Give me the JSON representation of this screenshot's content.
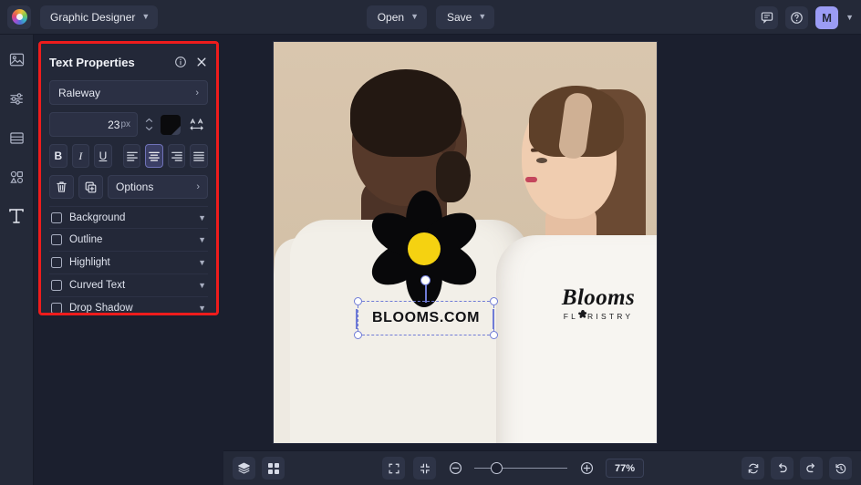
{
  "topbar": {
    "logo_name": "app-logo",
    "project_name": "Graphic Designer",
    "open_label": "Open",
    "save_label": "Save",
    "comment_icon": "comment-icon",
    "help_icon": "help-icon",
    "avatar_initial": "M"
  },
  "rail": {
    "items": [
      {
        "icon": "image-icon",
        "label": "Images"
      },
      {
        "icon": "adjustments-icon",
        "label": "Adjust"
      },
      {
        "icon": "layers-panel-icon",
        "label": "Layouts"
      },
      {
        "icon": "shapes-icon",
        "label": "Elements"
      },
      {
        "icon": "text-icon",
        "label": "Text"
      }
    ]
  },
  "panel": {
    "title": "Text Properties",
    "info_icon": "info-icon",
    "close_icon": "close-icon",
    "font_family": "Raleway",
    "font_size": "23",
    "font_size_unit": "px",
    "color_swatch": "#0b0b0d",
    "letter_spacing_icon": "letter-spacing-icon",
    "bold_label": "B",
    "italic_label": "I",
    "underline_label": "U",
    "align_options": [
      "align-left",
      "align-center",
      "align-right",
      "align-justify"
    ],
    "align_selected": "align-center",
    "delete_icon": "trash-icon",
    "duplicate_icon": "duplicate-icon",
    "options_label": "Options",
    "sections": [
      {
        "label": "Background",
        "checked": false
      },
      {
        "label": "Outline",
        "checked": false
      },
      {
        "label": "Highlight",
        "checked": false
      },
      {
        "label": "Curved Text",
        "checked": false
      },
      {
        "label": "Drop Shadow",
        "checked": false
      }
    ],
    "highlight_border_color": "#ee1c1c"
  },
  "canvas": {
    "selected_text": "BLOOMS.COM",
    "shirt_logo_script": "Blooms",
    "shirt_logo_sub_before": "FL",
    "shirt_logo_sub_after": "RISTRY",
    "flower_center_color": "#f5d211",
    "flower_petal_color": "#08080a"
  },
  "bottombar": {
    "layers_icon": "layers-icon",
    "grid_icon": "grid-icon",
    "fullscreen_icon": "fullscreen-icon",
    "fit_icon": "fit-to-screen-icon",
    "zoom_out_icon": "zoom-out-icon",
    "zoom_in_icon": "zoom-in-icon",
    "zoom_level": "77%",
    "reset_icon": "reset-icon",
    "undo_icon": "undo-icon",
    "redo_icon": "redo-icon",
    "history_icon": "history-icon"
  }
}
